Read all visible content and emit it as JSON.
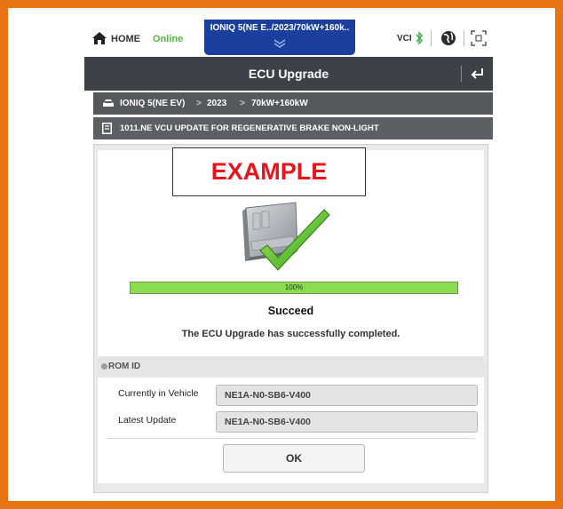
{
  "statusbar": {
    "home_label": "HOME",
    "online_label": "Online",
    "vehicle_tab": "IONIQ 5(NE E../2023/70kW+160k..",
    "vci_label": "VCI"
  },
  "titlebar": {
    "title": "ECU Upgrade"
  },
  "breadcrumb": {
    "items": [
      "IONIQ 5(NE EV)",
      "2023",
      "70kW+160kW"
    ],
    "separator": ">"
  },
  "document": {
    "title": "1011.NE VCU UPDATE FOR REGENERATIVE BRAKE NON-LIGHT"
  },
  "overlay": {
    "example_label": "EXAMPLE"
  },
  "progress": {
    "value": 1.0,
    "label": "100%"
  },
  "result": {
    "status": "Succeed",
    "message": "The ECU Upgrade has successfully completed."
  },
  "rom_id": {
    "header": "ROM ID",
    "rows": [
      {
        "label": "Currently in Vehicle",
        "value": "NE1A-N0-SB6-V400"
      },
      {
        "label": "Latest Update",
        "value": "NE1A-N0-SB6-V400"
      }
    ]
  },
  "actions": {
    "ok_label": "OK"
  },
  "colors": {
    "frame": "#e87511",
    "vehicle_tab": "#1a3f9c",
    "online": "#59b843",
    "example_text": "#e8141b",
    "progress": "#8bdb50"
  },
  "icons": [
    "home-icon",
    "chevron-down-icon",
    "bluetooth-icon",
    "globe-icon",
    "screen-capture-icon",
    "back-icon",
    "car-icon",
    "document-icon",
    "ecu-success-icon"
  ]
}
